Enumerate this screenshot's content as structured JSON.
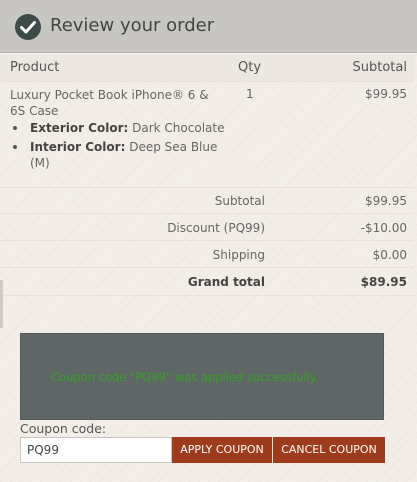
{
  "header": {
    "title": "Review your order",
    "icon": "check-circle-icon",
    "background": "#c8c6c3"
  },
  "table": {
    "columns": {
      "product": "Product",
      "qty": "Qty",
      "subtotal": "Subtotal"
    },
    "items": [
      {
        "name": "Luxury Pocket Book iPhone® 6 & 6S Case",
        "qty": "1",
        "subtotal": "$99.95",
        "options": [
          {
            "label": "Exterior Color:",
            "value": "Dark Chocolate"
          },
          {
            "label": "Interior Color:",
            "value": "Deep Sea Blue (M)"
          }
        ]
      }
    ],
    "totals": [
      {
        "label": "Subtotal",
        "value": "$99.95"
      },
      {
        "label": "Discount (PQ99)",
        "value": "-$10.00"
      },
      {
        "label": "Shipping",
        "value": "$0.00"
      },
      {
        "label": "Grand total",
        "value": "$89.95"
      }
    ]
  },
  "coupon": {
    "message": "Coupon code \"PQ99\" was applied successfully.",
    "label": "Coupon code:",
    "value": "PQ99",
    "apply_label": "APPLY COUPON",
    "cancel_label": "CANCEL COUPON",
    "button_color": "#9e3b1c",
    "message_color": "#2fa61c"
  }
}
